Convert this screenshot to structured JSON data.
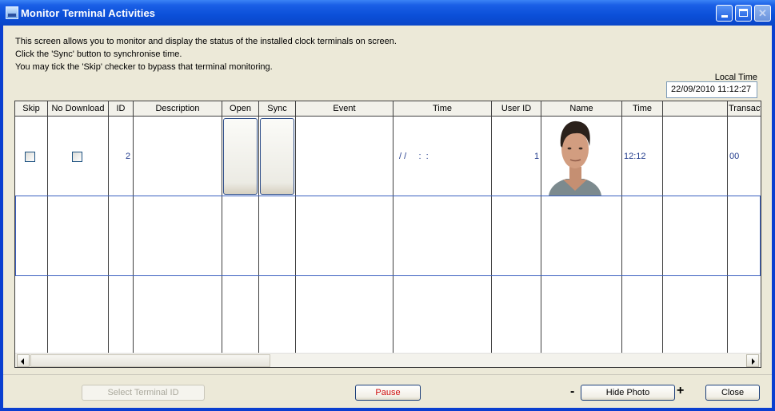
{
  "window": {
    "title": "Monitor Terminal Activities",
    "buttons": [
      "minimize",
      "maximize",
      "close"
    ]
  },
  "instructions": [
    "This screen allows you to monitor and display the status of the installed clock terminals on screen.",
    "Click the 'Sync' button to synchronise time.",
    "You may tick the 'Skip' checker to bypass that terminal monitoring."
  ],
  "local_time": {
    "label": "Local Time",
    "value": "22/09/2010 11:12:27"
  },
  "grid": {
    "columns": [
      "Skip",
      "No Download",
      "ID",
      "Description",
      "Open",
      "Sync",
      "Event",
      "Time",
      "User ID",
      "Name",
      "Time",
      "",
      "Transact"
    ],
    "rows": [
      {
        "skip": false,
        "no_download": false,
        "id": "2",
        "description": "",
        "event": "",
        "time": "/ /     :  :",
        "user_id": "1",
        "name_photo": "portrait-photo",
        "time2": "12:12",
        "blank": "",
        "transact": "00"
      }
    ]
  },
  "footer": {
    "select_terminal": "Select Terminal ID",
    "pause": "Pause",
    "minus": "-",
    "hide_photo": "Hide Photo",
    "plus": "+",
    "close": "Close"
  },
  "colors": {
    "title_bar": "#0b4fd8",
    "client_bg": "#ece9d8",
    "pause_text": "#d01010",
    "cell_text": "#203a8c"
  }
}
